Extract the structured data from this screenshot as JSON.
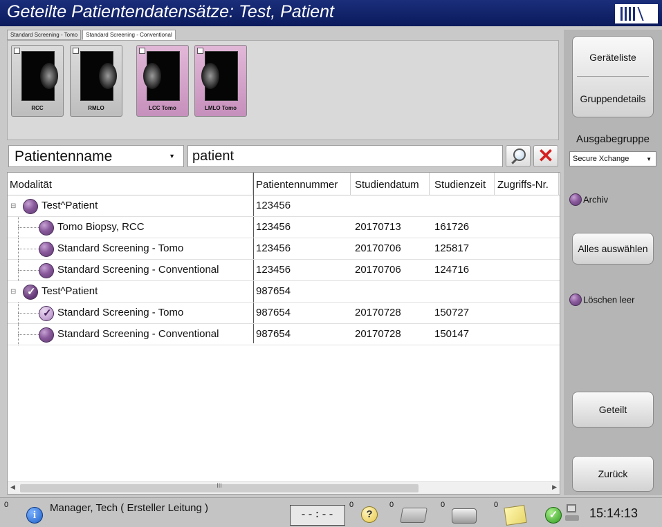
{
  "window": {
    "title": "Geteilte Patientendatensätze: Test, Patient"
  },
  "tabs": [
    {
      "label": "Standard Screening - Tomo",
      "active": false
    },
    {
      "label": "Standard Screening - Conventional",
      "active": true
    }
  ],
  "thumbnails": [
    {
      "label": "RCC",
      "side": "r",
      "tomo": false
    },
    {
      "label": "RMLO",
      "side": "r",
      "tomo": false
    },
    {
      "label": "LCC Tomo",
      "side": "l",
      "tomo": true
    },
    {
      "label": "LMLO Tomo",
      "side": "l",
      "tomo": true
    }
  ],
  "search": {
    "field_label": "Patientenname",
    "value": "patient",
    "search_icon": "magnifier-icon",
    "clear_icon": "red-x-icon",
    "clear_glyph": "✕"
  },
  "grid": {
    "columns": [
      "Modalität",
      "Patientennummer",
      "Studiendatum",
      "Studienzeit",
      "Zugriffs-Nr."
    ],
    "rows": [
      {
        "level": 0,
        "name": "Test^Patient",
        "id": "123456",
        "date": "",
        "time": "",
        "acc": "",
        "checked": false
      },
      {
        "level": 1,
        "name": "Tomo Biopsy, RCC",
        "id": "123456",
        "date": "20170713",
        "time": "161726",
        "acc": "",
        "checked": false
      },
      {
        "level": 1,
        "name": "Standard Screening - Tomo",
        "id": "123456",
        "date": "20170706",
        "time": "125817",
        "acc": "",
        "checked": false
      },
      {
        "level": 1,
        "name": "Standard Screening - Conventional",
        "id": "123456",
        "date": "20170706",
        "time": "124716",
        "acc": "",
        "checked": false
      },
      {
        "level": 0,
        "name": "Test^Patient",
        "id": "987654",
        "date": "",
        "time": "",
        "acc": "",
        "checked": true
      },
      {
        "level": 1,
        "name": "Standard Screening - Tomo",
        "id": "987654",
        "date": "20170728",
        "time": "150727",
        "acc": "",
        "checked": true
      },
      {
        "level": 1,
        "name": "Standard Screening - Conventional",
        "id": "987654",
        "date": "20170728",
        "time": "150147",
        "acc": "",
        "checked": false
      }
    ],
    "scroll_grip": "III"
  },
  "right_panel": {
    "device_list": "Geräteliste",
    "group_details": "Gruppendetails",
    "output_group_label": "Ausgabegruppe",
    "output_group_value": "Secure Xchange",
    "archive": "Archiv",
    "select_all": "Alles auswählen",
    "delete_empty": "Löschen leer",
    "shared": "Geteilt",
    "back": "Zurück"
  },
  "status_bar": {
    "count_info": "0",
    "user": "Manager, Tech ( Ersteller Leitung )",
    "timer": "--:--",
    "count_help": "0",
    "count_case": "0",
    "count_printer": "0",
    "count_note": "0",
    "clock": "15:14:13",
    "icons": [
      "info-icon",
      "help-icon",
      "case-icon",
      "printer-icon",
      "note-icon",
      "ok-check-icon",
      "network-icon"
    ]
  },
  "colors": {
    "titlebar": "#0b1a5c",
    "accent_purple": "#8a5a9c",
    "clear_red": "#d62020"
  }
}
